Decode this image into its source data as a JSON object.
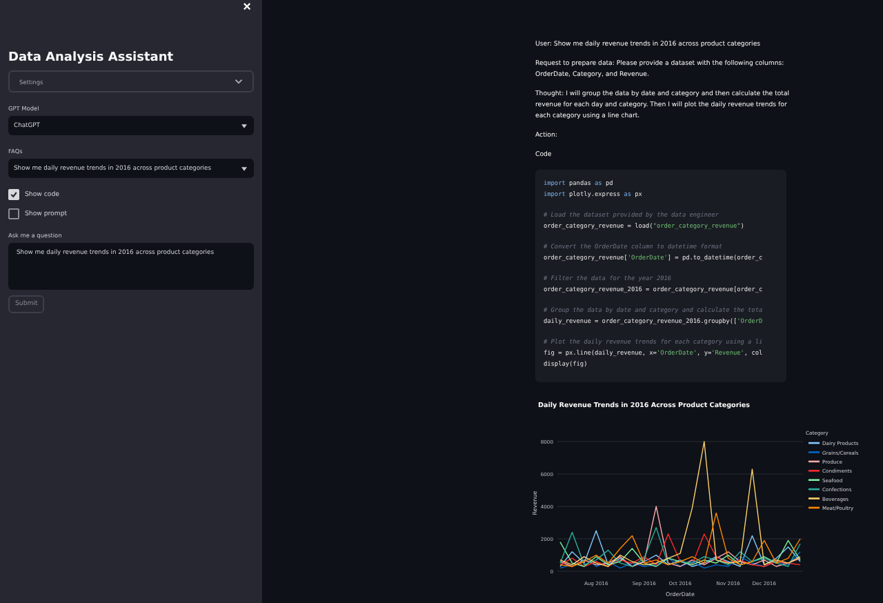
{
  "sidebar": {
    "close": "×",
    "title": "Data Analysis Assistant",
    "settings": {
      "label": "Settings",
      "expanded": false
    },
    "gpt_model": {
      "label": "GPT Model",
      "value": "ChatGPT"
    },
    "faqs": {
      "label": "FAQs",
      "value": "Show me daily revenue trends in 2016 across product categories"
    },
    "checkboxes": [
      {
        "label": "Show code",
        "checked": true
      },
      {
        "label": "Show prompt",
        "checked": false
      }
    ],
    "question": {
      "label": "Ask me a question",
      "value": "Show me daily revenue trends in 2016 across product categories"
    },
    "submit": "Submit"
  },
  "main": {
    "paragraphs": [
      "User: Show me daily revenue trends in 2016 across product categories",
      "Request to prepare data: Please provide a dataset with the following columns: OrderDate, Category, and Revenue.",
      "Thought: I will group the data by date and category and then calculate the total revenue for each day and category. Then I will plot the daily revenue trends for each category using a line chart.",
      "Action:",
      "Code"
    ],
    "code": [
      {
        "kind": "code",
        "tokens": [
          {
            "kind": "kw",
            "text": "import"
          },
          {
            "kind": "plain",
            "text": " pandas "
          },
          {
            "kind": "kw",
            "text": "as"
          },
          {
            "kind": "plain",
            "text": " pd"
          }
        ]
      },
      {
        "kind": "code",
        "tokens": [
          {
            "kind": "kw",
            "text": "import"
          },
          {
            "kind": "plain",
            "text": " plotly.express "
          },
          {
            "kind": "kw",
            "text": "as"
          },
          {
            "kind": "plain",
            "text": " px"
          }
        ]
      },
      {
        "kind": "blank"
      },
      {
        "kind": "code",
        "tokens": [
          {
            "kind": "comment",
            "text": "# Load the dataset provided by the data engineer"
          }
        ]
      },
      {
        "kind": "code",
        "tokens": [
          {
            "kind": "plain",
            "text": "order_category_revenue = load("
          },
          {
            "kind": "str",
            "text": "\"order_category_revenue\""
          },
          {
            "kind": "plain",
            "text": ")"
          }
        ]
      },
      {
        "kind": "blank"
      },
      {
        "kind": "code",
        "tokens": [
          {
            "kind": "comment",
            "text": "# Convert the OrderDate column to datetime format"
          }
        ]
      },
      {
        "kind": "code",
        "tokens": [
          {
            "kind": "plain",
            "text": "order_category_revenue["
          },
          {
            "kind": "str",
            "text": "'OrderDate'"
          },
          {
            "kind": "plain",
            "text": "] = pd.to_datetime(order_c"
          }
        ]
      },
      {
        "kind": "blank"
      },
      {
        "kind": "code",
        "tokens": [
          {
            "kind": "comment",
            "text": "# Filter the data for the year 2016"
          }
        ]
      },
      {
        "kind": "code",
        "tokens": [
          {
            "kind": "plain",
            "text": "order_category_revenue_2016 = order_category_revenue[order_c"
          }
        ]
      },
      {
        "kind": "blank"
      },
      {
        "kind": "code",
        "tokens": [
          {
            "kind": "comment",
            "text": "# Group the data by date and category and calculate the tota"
          }
        ]
      },
      {
        "kind": "code",
        "tokens": [
          {
            "kind": "plain",
            "text": "daily_revenue = order_category_revenue_2016.groupby(["
          },
          {
            "kind": "str",
            "text": "'OrderD"
          }
        ]
      },
      {
        "kind": "blank"
      },
      {
        "kind": "code",
        "tokens": [
          {
            "kind": "comment",
            "text": "# Plot the daily revenue trends for each category using a li"
          }
        ]
      },
      {
        "kind": "code",
        "tokens": [
          {
            "kind": "plain",
            "text": "fig = px.line(daily_revenue, x="
          },
          {
            "kind": "str",
            "text": "'OrderDate'"
          },
          {
            "kind": "plain",
            "text": ", y="
          },
          {
            "kind": "str",
            "text": "'Revenue'"
          },
          {
            "kind": "plain",
            "text": ", col"
          }
        ]
      },
      {
        "kind": "code",
        "tokens": [
          {
            "kind": "plain",
            "text": "display(fig)"
          }
        ]
      }
    ],
    "chart": {
      "chart_data": {
        "type": "line",
        "title": "Daily Revenue Trends in 2016 Across Product Categories",
        "xlabel": "OrderDate",
        "ylabel": "Revenue",
        "categories": [
          null,
          null,
          null,
          "Aug 2016",
          null,
          null,
          null,
          "Sep 2016",
          null,
          null,
          "Oct 2016",
          null,
          null,
          null,
          "Nov 2016",
          null,
          null,
          "Dec 2016",
          null,
          null,
          null
        ],
        "grid": true,
        "ylim": [
          0,
          8000
        ],
        "legend": {
          "title": "Category"
        },
        "yticks": [
          8000,
          6000,
          4000,
          2000,
          0
        ],
        "series": [
          {
            "name": "Dairy Products",
            "color": "#83c9ff",
            "values": [
              300,
              1200,
              500,
              2500,
              400,
              800,
              300,
              600,
              1000,
              400,
              700,
              300,
              500,
              900,
              600,
              300,
              2200,
              400,
              800,
              1500,
              600
            ]
          },
          {
            "name": "Grains/Cereals",
            "color": "#0068c9",
            "values": [
              200,
              400,
              900,
              300,
              600,
              200,
              500,
              300,
              400,
              800,
              300,
              600,
              200,
              400,
              300,
              900,
              500,
              300,
              600,
              400,
              1200
            ]
          },
          {
            "name": "Produce",
            "color": "#ffabab",
            "values": [
              600,
              300,
              700,
              400,
              500,
              900,
              300,
              600,
              4000,
              500,
              300,
              700,
              400,
              800,
              1200,
              600,
              400,
              700,
              300,
              500,
              800
            ]
          },
          {
            "name": "Condiments",
            "color": "#ff2b2b",
            "values": [
              400,
              800,
              300,
              600,
              300,
              700,
              500,
              900,
              400,
              2300,
              600,
              400,
              2300,
              900,
              500,
              700,
              400,
              300,
              600,
              500,
              400
            ]
          },
          {
            "name": "Seafood",
            "color": "#7defa1",
            "values": [
              1800,
              500,
              300,
              900,
              400,
              600,
              1400,
              500,
              300,
              800,
              600,
              400,
              700,
              500,
              1000,
              400,
              600,
              900,
              500,
              1900,
              700
            ]
          },
          {
            "name": "Confections",
            "color": "#29b09d",
            "values": [
              500,
              2400,
              400,
              700,
              1300,
              500,
              300,
              800,
              2700,
              400,
              600,
              500,
              900,
              700,
              400,
              1200,
              600,
              800,
              500,
              300,
              1700
            ]
          },
          {
            "name": "Beverages",
            "color": "#ffd16a",
            "values": [
              700,
              400,
              900,
              500,
              300,
              1000,
              600,
              400,
              500,
              800,
              1100,
              3900,
              8000,
              700,
              500,
              600,
              6300,
              400,
              700,
              500,
              900
            ]
          },
          {
            "name": "Meat/Poultry",
            "color": "#ff8700",
            "values": [
              400,
              300,
              600,
              1000,
              500,
              1400,
              2200,
              500,
              700,
              400,
              600,
              900,
              500,
              3600,
              800,
              400,
              600,
              1900,
              500,
              800,
              2000
            ]
          }
        ]
      }
    }
  }
}
